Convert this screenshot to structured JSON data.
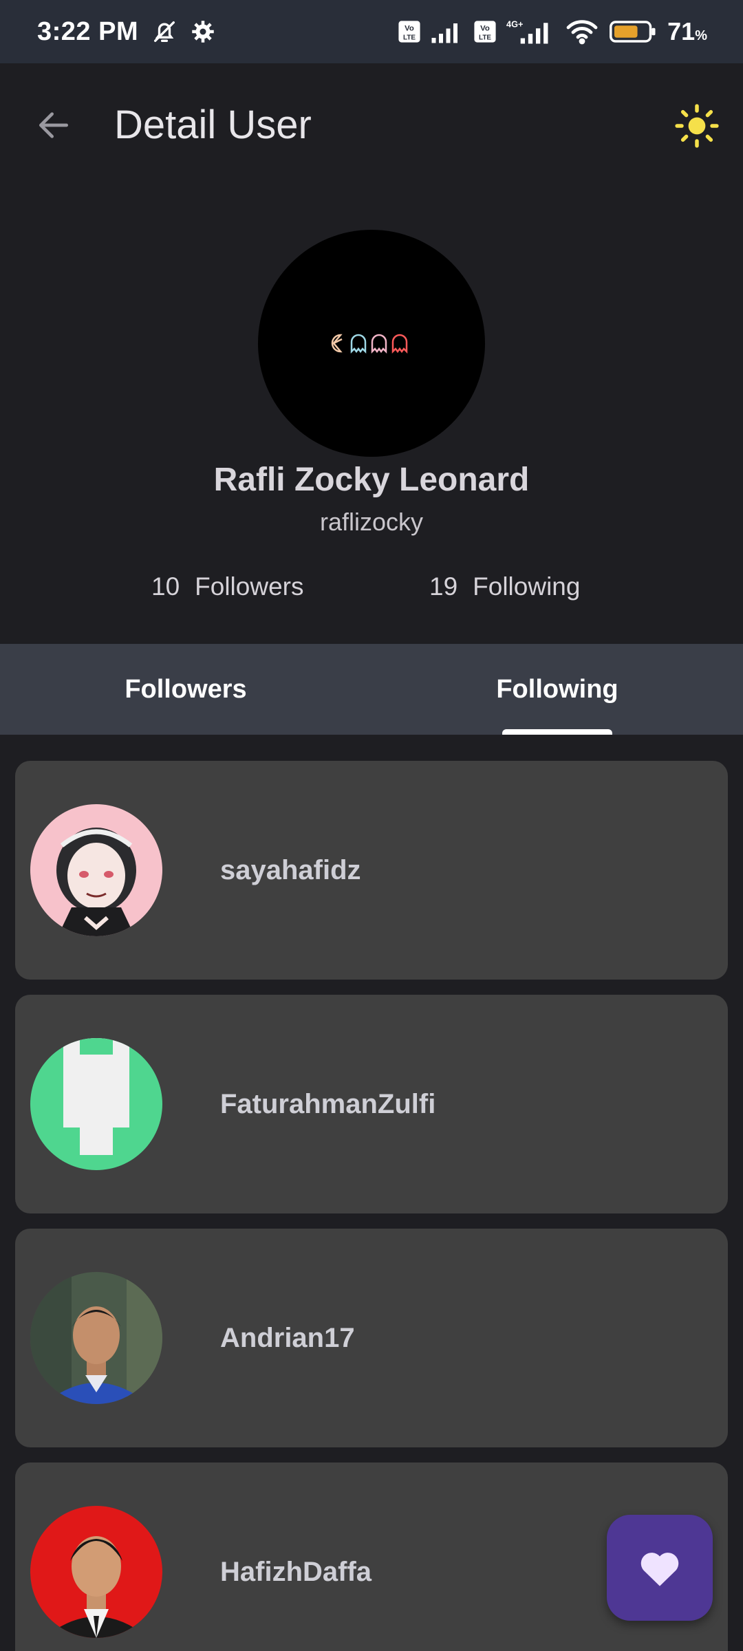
{
  "status_bar": {
    "time": "3:22 PM",
    "battery_percent": "71",
    "battery_unit": "%",
    "battery_level": 0.71,
    "icons": [
      "bell-off-icon",
      "settings-icon",
      "volte-icon",
      "signal-icon",
      "volte-icon",
      "4g-signal-icon",
      "wifi-icon",
      "battery-icon"
    ],
    "network_label": "4G+"
  },
  "app_bar": {
    "title": "Detail User",
    "back_icon": "arrow-left-icon",
    "theme_icon": "sun-icon"
  },
  "profile": {
    "name": "Rafli Zocky Leonard",
    "username": "raflizocky",
    "followers_count": "10",
    "followers_label": "Followers",
    "following_count": "19",
    "following_label": "Following"
  },
  "tabs": [
    {
      "label": "Followers",
      "selected": false
    },
    {
      "label": "Following",
      "selected": true
    }
  ],
  "users": [
    {
      "login": "sayahafidz"
    },
    {
      "login": "FaturahmanZulfi"
    },
    {
      "login": "Andrian17"
    },
    {
      "login": "HafizhDaffa"
    }
  ],
  "fab": {
    "icon": "heart-icon"
  },
  "colors": {
    "background": "#1e1e22",
    "status_bar": "#292e39",
    "tab_bar": "#3a3e48",
    "card": "#404040",
    "fab": "#4e3794",
    "sun": "#f5e04a",
    "battery": "#e6a12b"
  }
}
